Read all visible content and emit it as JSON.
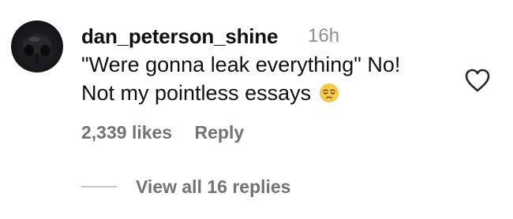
{
  "comment": {
    "username": "dan_peterson_shine",
    "timestamp": "16h",
    "text_line1": "\"Were gonna leak everything\" No!",
    "text_line2": "Not my pointless essays",
    "emoji": "pensive-face",
    "likes": "2,339 likes",
    "reply_label": "Reply",
    "view_replies_label": "View all 16 replies"
  },
  "colors": {
    "text": "#111111",
    "secondary": "#737373",
    "timestamp": "#8e8e8e",
    "divider": "#c7c7c7",
    "emoji": "#f7c948"
  }
}
